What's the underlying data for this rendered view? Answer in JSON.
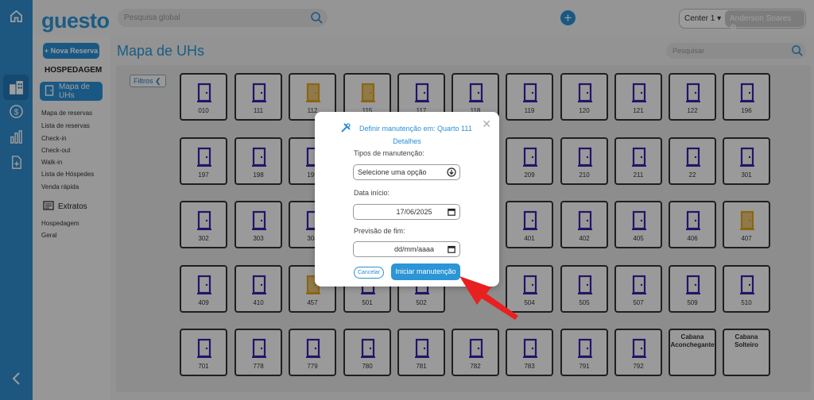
{
  "app": {
    "logo": "guesto"
  },
  "topbar": {
    "search_placeholder": "Pesquisa global",
    "add_label": "+",
    "center": "Center 1",
    "user": "Anderson Soares"
  },
  "sidebar": {
    "new_reservation": "+ Nova Reserva",
    "section": "HOSPEDAGEM",
    "active_item": "Mapa de UHs",
    "links": [
      "Mapa de reservas",
      "Lista de reservas",
      "Check-in",
      "Check-out",
      "Walk-in",
      "Lista de Hóspedes",
      "Venda rápida"
    ],
    "extratos": "Extratos",
    "extratos_links": [
      "Hospedagem",
      "Geral"
    ]
  },
  "main": {
    "title": "Mapa de UHs",
    "search_placeholder": "Pesquisar",
    "filters_label": "Filtros"
  },
  "rooms": [
    [
      "010",
      "111",
      "112",
      "115",
      "117",
      "118",
      "119",
      "120",
      "121",
      "122",
      "196"
    ],
    [
      "197",
      "198",
      "199",
      "",
      "",
      "",
      "209",
      "210",
      "211",
      "22",
      "301"
    ],
    [
      "302",
      "303",
      "304",
      "",
      "",
      "",
      "401",
      "402",
      "405",
      "406",
      "407"
    ],
    [
      "409",
      "410",
      "457",
      "501",
      "502",
      "",
      "504",
      "505",
      "507",
      "509",
      "510"
    ],
    [
      "701",
      "778",
      "779",
      "780",
      "781",
      "782",
      "783",
      "791",
      "792",
      "Cabana Aconchegante",
      "Cabana Solteiro"
    ]
  ],
  "maintenance_rooms": [
    "112",
    "115",
    "407",
    "457"
  ],
  "modal": {
    "title": "Definir manutenção em: Quarto 111",
    "subtitle": "Detalhes",
    "type_label": "Tipos de manutenção:",
    "type_value": "Selecione uma opção",
    "start_label": "Data início:",
    "start_value": "17/06/2025",
    "end_label": "Previsão de fim:",
    "end_value": "dd/mm/aaaa",
    "cancel": "Cancelar",
    "submit": "Iniciar manutenção"
  },
  "colors": {
    "brand": "#2b95d6",
    "door": "#3a1fa8",
    "maintenance": "#e0a321",
    "annotation": "#e82020"
  }
}
